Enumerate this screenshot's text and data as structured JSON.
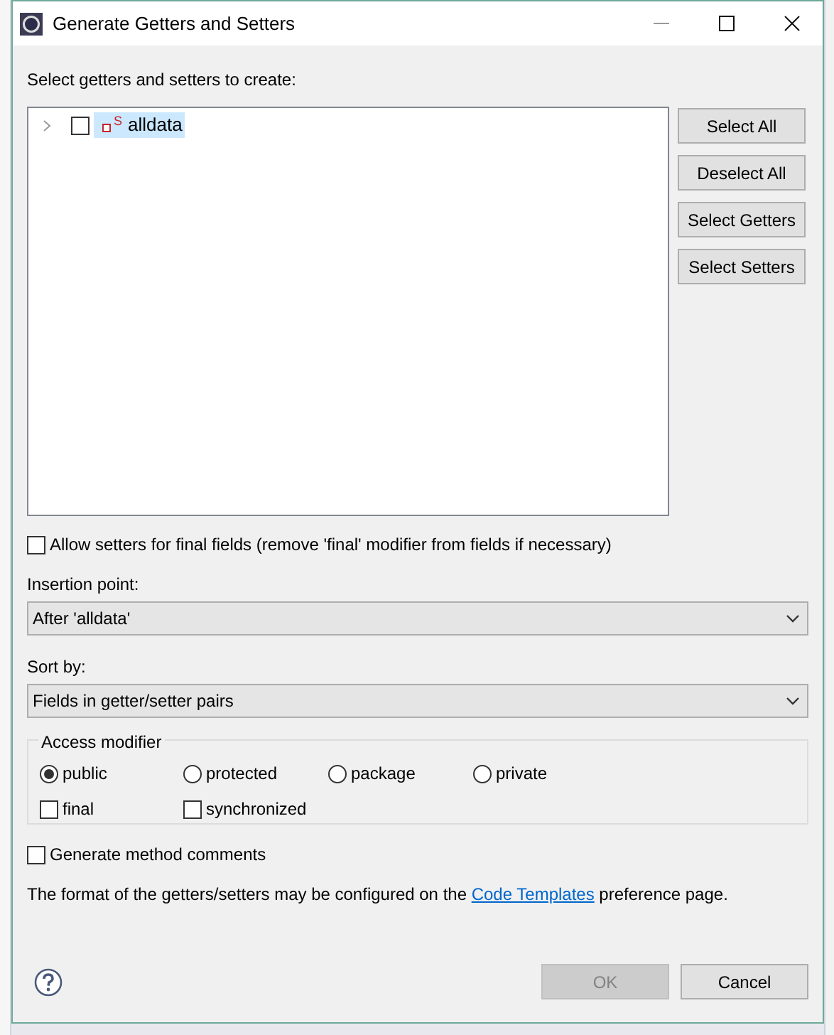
{
  "window": {
    "title": "Generate Getters and Setters"
  },
  "tree": {
    "label": "Select getters and setters to create:",
    "items": [
      {
        "label": "alldata",
        "badge": "S",
        "expanded": false,
        "checked": false,
        "selected": true
      }
    ]
  },
  "side_buttons": [
    "Select All",
    "Deselect All",
    "Select Getters",
    "Select Setters"
  ],
  "allow_final": {
    "label": "Allow setters for final fields (remove 'final' modifier from fields if necessary)",
    "checked": false
  },
  "insertion_point": {
    "label": "Insertion point:",
    "value": "After 'alldata'"
  },
  "sort_by": {
    "label": "Sort by:",
    "value": "Fields in getter/setter pairs"
  },
  "access_modifier": {
    "title": "Access modifier",
    "options": [
      {
        "label": "public",
        "selected": true
      },
      {
        "label": "protected",
        "selected": false
      },
      {
        "label": "package",
        "selected": false
      },
      {
        "label": "private",
        "selected": false
      }
    ],
    "flags": [
      {
        "label": "final",
        "checked": false
      },
      {
        "label": "synchronized",
        "checked": false
      }
    ]
  },
  "method_comments": {
    "label": "Generate method comments",
    "checked": false
  },
  "info": {
    "before": "The format of the getters/setters may be configured on the ",
    "link": "Code Templates",
    "after": " preference page."
  },
  "buttons": [
    {
      "label": "OK",
      "disabled": true
    },
    {
      "label": "Cancel",
      "disabled": false
    }
  ]
}
